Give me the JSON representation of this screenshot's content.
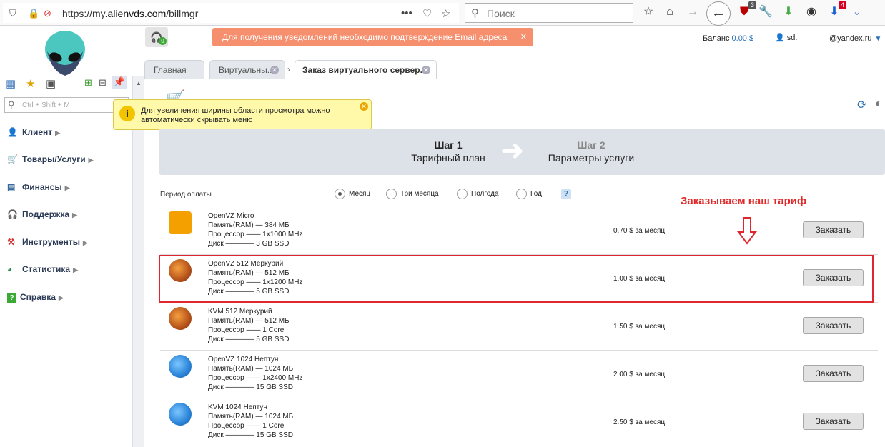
{
  "browser": {
    "url_prefix": "https://my.",
    "url_host": "alienvds.com",
    "url_path": "/billmgr",
    "search_placeholder": "Поиск",
    "badges": {
      "ublock": "3",
      "downloads": "4"
    }
  },
  "header": {
    "email_alert": "Для получения уведомлений необходимо подтверждение Email адреса",
    "balance_label": "Баланс",
    "balance_value": "0.00 $",
    "user_name": "sd.",
    "user_email": "@yandex.ru",
    "notif_count": "0"
  },
  "sidebar": {
    "search_placeholder": "Ctrl + Shift + M",
    "items": [
      {
        "label": "Клиент",
        "icon": "client-icon"
      },
      {
        "label": "Товары/Услуги",
        "icon": "cart-icon"
      },
      {
        "label": "Финансы",
        "icon": "finance-icon"
      },
      {
        "label": "Поддержка",
        "icon": "headset-icon"
      },
      {
        "label": "Инструменты",
        "icon": "tools-icon"
      },
      {
        "label": "Статистика",
        "icon": "chart-icon"
      },
      {
        "label": "Справка",
        "icon": "help-icon"
      }
    ]
  },
  "tooltip": {
    "text": "Для увеличения ширины области просмотра можно автоматически скрывать меню"
  },
  "tabs": [
    {
      "label": "Главная"
    },
    {
      "label": "Виртуальны..."
    },
    {
      "label": "Заказ виртуального сервер..."
    }
  ],
  "steps": [
    {
      "title": "Шаг 1",
      "subtitle": "Тарифный план"
    },
    {
      "title": "Шаг 2",
      "subtitle": "Параметры услуги"
    }
  ],
  "period": {
    "label": "Период оплаты",
    "options": [
      "Месяц",
      "Три месяца",
      "Полгода",
      "Год"
    ],
    "selected": "Месяц",
    "help": "?"
  },
  "annotation": "Заказываем наш тариф",
  "order_label": "Заказать",
  "plans": [
    {
      "name": "OpenVZ Micro",
      "ram": "Память(RAM) — 384 МБ",
      "cpu": "Процессор —— 1x1000 MHz",
      "disk": "Диск ———— 3 GB SSD",
      "price": "0.70 $ за месяц",
      "image": "hot"
    },
    {
      "name": "OpenVZ 512 Меркурий",
      "ram": "Память(RAM) — 512 МБ",
      "cpu": "Процессор —— 1x1200 MHz",
      "disk": "Диск ———— 5 GB SSD",
      "price": "1.00 $ за месяц",
      "image": "merc"
    },
    {
      "name": "KVM 512 Меркурий",
      "ram": "Память(RAM) — 512 МБ",
      "cpu": "Процессор —— 1 Core",
      "disk": "Диск ———— 5 GB SSD",
      "price": "1.50 $ за месяц",
      "image": "merc"
    },
    {
      "name": "OpenVZ 1024 Нептун",
      "ram": "Память(RAM) — 1024 МБ",
      "cpu": "Процессор —— 1x2400 MHz",
      "disk": "Диск ———— 15 GB SSD",
      "price": "2.00 $ за месяц",
      "image": "nep"
    },
    {
      "name": "KVM 1024 Нептун",
      "ram": "Память(RAM) — 1024 МБ",
      "cpu": "Процессор —— 1 Core",
      "disk": "Диск ———— 15 GB SSD",
      "price": "2.50 $ за месяц",
      "image": "nep"
    }
  ]
}
